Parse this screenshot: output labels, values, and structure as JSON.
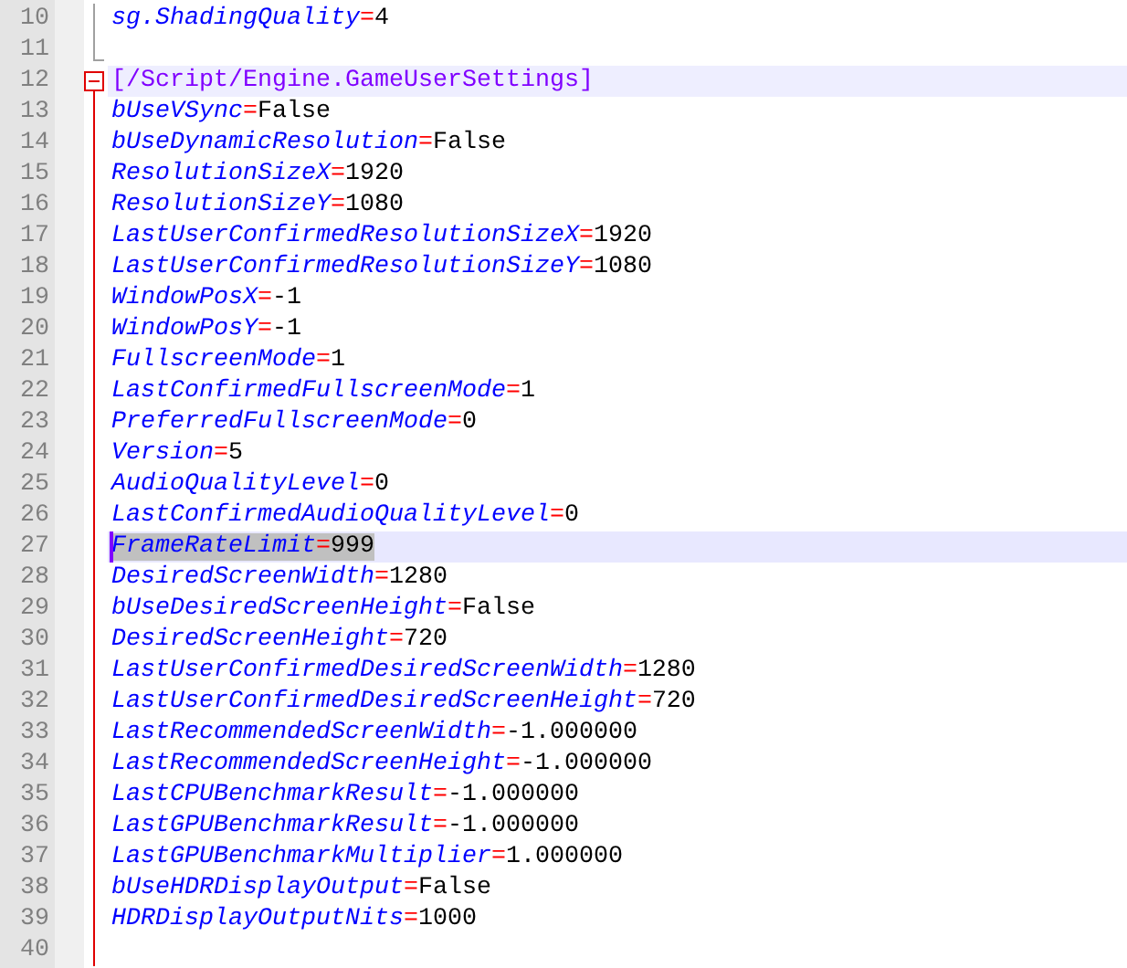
{
  "lines": [
    {
      "number": "10",
      "kind": "setting",
      "key": "sg.ShadingQuality",
      "separator": "=",
      "value": "4"
    },
    {
      "number": "11",
      "kind": "blank"
    },
    {
      "number": "12",
      "kind": "section",
      "text": "[/Script/Engine.GameUserSettings]"
    },
    {
      "number": "13",
      "kind": "setting",
      "key": "bUseVSync",
      "separator": "=",
      "value": "False"
    },
    {
      "number": "14",
      "kind": "setting",
      "key": "bUseDynamicResolution",
      "separator": "=",
      "value": "False"
    },
    {
      "number": "15",
      "kind": "setting",
      "key": "ResolutionSizeX",
      "separator": "=",
      "value": "1920"
    },
    {
      "number": "16",
      "kind": "setting",
      "key": "ResolutionSizeY",
      "separator": "=",
      "value": "1080"
    },
    {
      "number": "17",
      "kind": "setting",
      "key": "LastUserConfirmedResolutionSizeX",
      "separator": "=",
      "value": "1920"
    },
    {
      "number": "18",
      "kind": "setting",
      "key": "LastUserConfirmedResolutionSizeY",
      "separator": "=",
      "value": "1080"
    },
    {
      "number": "19",
      "kind": "setting",
      "key": "WindowPosX",
      "separator": "=",
      "value": "-1"
    },
    {
      "number": "20",
      "kind": "setting",
      "key": "WindowPosY",
      "separator": "=",
      "value": "-1"
    },
    {
      "number": "21",
      "kind": "setting",
      "key": "FullscreenMode",
      "separator": "=",
      "value": "1"
    },
    {
      "number": "22",
      "kind": "setting",
      "key": "LastConfirmedFullscreenMode",
      "separator": "=",
      "value": "1"
    },
    {
      "number": "23",
      "kind": "setting",
      "key": "PreferredFullscreenMode",
      "separator": "=",
      "value": "0"
    },
    {
      "number": "24",
      "kind": "setting",
      "key": "Version",
      "separator": "=",
      "value": "5"
    },
    {
      "number": "25",
      "kind": "setting",
      "key": "AudioQualityLevel",
      "separator": "=",
      "value": "0"
    },
    {
      "number": "26",
      "kind": "setting",
      "key": "LastConfirmedAudioQualityLevel",
      "separator": "=",
      "value": "0"
    },
    {
      "number": "27",
      "kind": "setting",
      "key": "FrameRateLimit",
      "separator": "=",
      "value": "999",
      "current": true,
      "selected": true
    },
    {
      "number": "28",
      "kind": "setting",
      "key": "DesiredScreenWidth",
      "separator": "=",
      "value": "1280"
    },
    {
      "number": "29",
      "kind": "setting",
      "key": "bUseDesiredScreenHeight",
      "separator": "=",
      "value": "False"
    },
    {
      "number": "30",
      "kind": "setting",
      "key": "DesiredScreenHeight",
      "separator": "=",
      "value": "720"
    },
    {
      "number": "31",
      "kind": "setting",
      "key": "LastUserConfirmedDesiredScreenWidth",
      "separator": "=",
      "value": "1280"
    },
    {
      "number": "32",
      "kind": "setting",
      "key": "LastUserConfirmedDesiredScreenHeight",
      "separator": "=",
      "value": "720"
    },
    {
      "number": "33",
      "kind": "setting",
      "key": "LastRecommendedScreenWidth",
      "separator": "=",
      "value": "-1.000000"
    },
    {
      "number": "34",
      "kind": "setting",
      "key": "LastRecommendedScreenHeight",
      "separator": "=",
      "value": "-1.000000"
    },
    {
      "number": "35",
      "kind": "setting",
      "key": "LastCPUBenchmarkResult",
      "separator": "=",
      "value": "-1.000000"
    },
    {
      "number": "36",
      "kind": "setting",
      "key": "LastGPUBenchmarkResult",
      "separator": "=",
      "value": "-1.000000"
    },
    {
      "number": "37",
      "kind": "setting",
      "key": "LastGPUBenchmarkMultiplier",
      "separator": "=",
      "value": "1.000000"
    },
    {
      "number": "38",
      "kind": "setting",
      "key": "bUseHDRDisplayOutput",
      "separator": "=",
      "value": "False"
    },
    {
      "number": "39",
      "kind": "setting",
      "key": "HDRDisplayOutputNits",
      "separator": "=",
      "value": "1000"
    },
    {
      "number": "40",
      "kind": "blank"
    }
  ]
}
